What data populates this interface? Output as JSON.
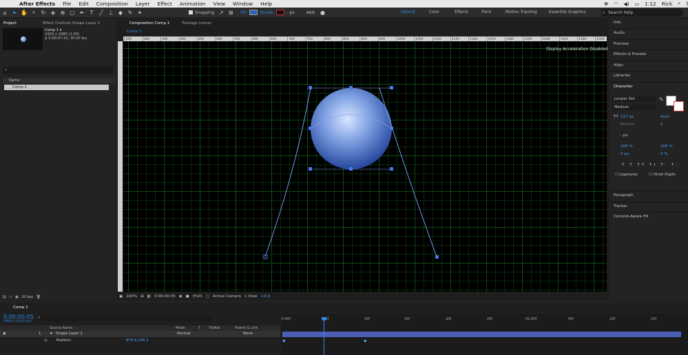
{
  "menubar": {
    "app": "After Effects",
    "items": [
      "File",
      "Edit",
      "Composition",
      "Layer",
      "Effect",
      "Animation",
      "View",
      "Window",
      "Help"
    ],
    "time": "Sun 1:12 PM",
    "user": "Rick"
  },
  "toolbar": {
    "snapping": "Snapping",
    "fill": "Fill:",
    "stroke": "Stroke:",
    "stroke_width": "- px",
    "add": "Add:",
    "workspaces": [
      "Default",
      "Color",
      "Effects",
      "Paint",
      "Motion Tracking",
      "Essential Graphics"
    ],
    "search_placeholder": "Search Help"
  },
  "project": {
    "tabs": [
      "Project",
      "Effect Controls Shape Layer 1"
    ],
    "comp_name": "Comp 1 ▾",
    "comp_info_1": "1920 x 1080 (1.00)",
    "comp_info_2": "Δ 0:00:07:16, 30.00 fps",
    "column_name": "Name",
    "row": "Comp 1",
    "bpc": "16 bpc"
  },
  "viewer": {
    "tabs": [
      "Composition Comp 1",
      "Footage (none)"
    ],
    "subtab": "Comp 1",
    "ruler_labels": [
      "250",
      "300",
      "350",
      "400",
      "450",
      "500",
      "550",
      "600",
      "650",
      "700",
      "750",
      "800",
      "850",
      "900",
      "950",
      "1000",
      "1050",
      "1100",
      "1150",
      "1200",
      "1250",
      "1300",
      "1350",
      "1400",
      "1450",
      "1500",
      "1550"
    ],
    "accel_notice": "Display Acceleration Disabled",
    "zoom": "100%",
    "timecode": "0:00:00:05",
    "resolution": "(Full)",
    "camera": "Active Camera",
    "view": "1 View",
    "exposure": "+0.0"
  },
  "right_panel": {
    "items": [
      "Info",
      "Audio",
      "Preview",
      "Effects & Presets",
      "Align",
      "Libraries"
    ],
    "character": "Character",
    "font": "Juniper Std",
    "style": "Medium",
    "size": "127 px",
    "leading": "Auto",
    "kerning": "Metrics",
    "tracking": "0",
    "stroke_px": "- px",
    "vscale": "100 %",
    "hscale": "100 %",
    "baseline": "0 px",
    "tsume": "0 %",
    "ligatures": "Ligatures",
    "hindi": "Hindi Digits",
    "sections": [
      "Paragraph",
      "Tracker",
      "Content-Aware Fill"
    ]
  },
  "timeline": {
    "tab": "Comp 1",
    "time": "0:00:00:05",
    "fps": "00005 (30.00 fps)",
    "headers": [
      "Source Name",
      "Mode",
      "T",
      "TrkMat",
      "Parent & Link"
    ],
    "layer_index": "1",
    "layer_name": "Shape Layer 1",
    "layer_mode": "Normal",
    "parent": "None",
    "prop_name": "Position",
    "prop_value": "879.9,200.2",
    "ruler_labels": [
      "0:00f",
      "05f",
      "10f",
      "15f",
      "20f",
      "25f",
      "01:00f",
      "05f",
      "10f",
      "15f"
    ]
  },
  "colors": {
    "accent": "#2d8ceb",
    "layer_bar": "#4b5fb8"
  }
}
